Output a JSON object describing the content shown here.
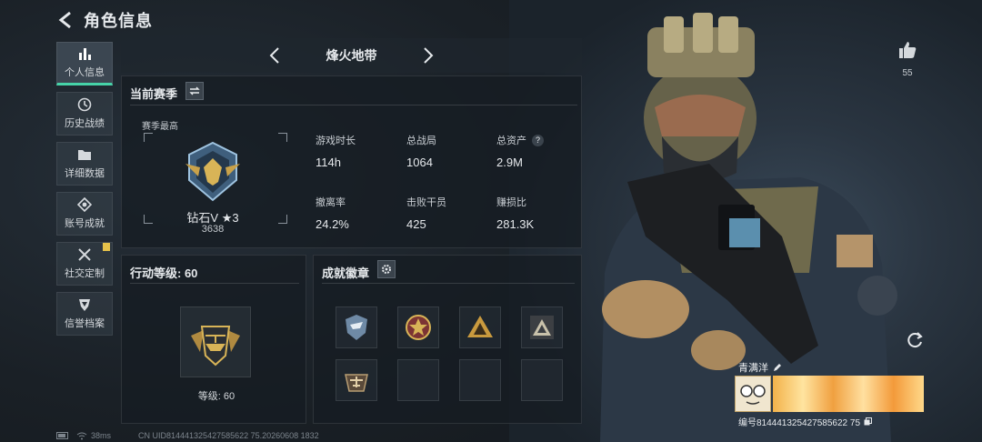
{
  "header": {
    "title": "角色信息"
  },
  "sidebar": {
    "items": [
      {
        "label": "个人信息",
        "icon": "bar-chart-icon",
        "active": true
      },
      {
        "label": "历史战绩",
        "icon": "history-icon"
      },
      {
        "label": "详细数据",
        "icon": "folder-icon"
      },
      {
        "label": "账号成就",
        "icon": "achievement-icon"
      },
      {
        "label": "社交定制",
        "icon": "tools-icon",
        "badge": "!"
      },
      {
        "label": "信誉档案",
        "icon": "credit-shield-icon"
      }
    ]
  },
  "map_selector": {
    "current": "烽火地带"
  },
  "season": {
    "title": "当前赛季",
    "best_label": "赛季最高",
    "rank_name": "钻石V ★3",
    "rank_score": "3638",
    "stats": [
      {
        "label": "游戏时长",
        "value": "114h"
      },
      {
        "label": "总战局",
        "value": "1064"
      },
      {
        "label": "总资产",
        "value": "2.9M",
        "help": "?"
      },
      {
        "label": "撤离率",
        "value": "24.2%"
      },
      {
        "label": "击败干员",
        "value": "425"
      },
      {
        "label": "赚损比",
        "value": "281.3K"
      }
    ]
  },
  "action_level": {
    "title": "行动等级: 60",
    "level_text": "等级: 60"
  },
  "achievements": {
    "title": "成就徽章",
    "badges": [
      "eagle-shield-badge-icon",
      "star-medal-badge-icon",
      "gold-triangle-badge-icon",
      "dark-triangle-badge-icon",
      "aircraft-badge-icon",
      "",
      "",
      ""
    ]
  },
  "status": {
    "ping": "38ms",
    "uid_line": "CN UID814441325427585622 75.20260608 1832"
  },
  "character": {
    "likes": "55",
    "name": "青满洋",
    "serial": "编号814441325427585622 75"
  },
  "colors": {
    "accent": "#46d3a8",
    "gold": "#d8b457",
    "badge_warn": "#e6c24a"
  }
}
